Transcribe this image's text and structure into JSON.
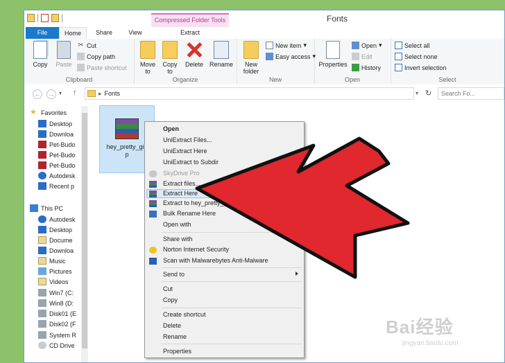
{
  "window": {
    "title": "Fonts",
    "context_tool": "Compressed Folder Tools"
  },
  "tabs": {
    "file": "File",
    "home": "Home",
    "share": "Share",
    "view": "View",
    "extract": "Extract"
  },
  "ribbon": {
    "clipboard": {
      "label": "Clipboard",
      "copy": "Copy",
      "paste": "Paste",
      "cut": "Cut",
      "copy_path": "Copy path",
      "paste_shortcut": "Paste shortcut"
    },
    "organize": {
      "label": "Organize",
      "move_to": "Move\nto",
      "copy_to": "Copy\nto",
      "delete": "Delete",
      "rename": "Rename"
    },
    "new": {
      "label": "New",
      "new_folder": "New\nfolder",
      "new_item": "New item",
      "easy_access": "Easy access"
    },
    "open": {
      "label": "Open",
      "properties": "Properties",
      "open": "Open",
      "edit": "Edit",
      "history": "History"
    },
    "select": {
      "label": "Select",
      "select_all": "Select all",
      "select_none": "Select none",
      "invert_selection": "Invert selection"
    }
  },
  "address": {
    "path": "Fonts",
    "search_placeholder": "Search Fo..."
  },
  "nav": {
    "favorites": "Favorites",
    "fav_items": [
      "Desktop",
      "Downloa",
      "Pet-Budo",
      "Pet-Budo",
      "Pet-Budo",
      "Autodesk",
      "Recent p"
    ],
    "this_pc": "This PC",
    "pc_items": [
      "Autodesk",
      "Desktop",
      "Docume",
      "Downloa",
      "Music",
      "Pictures",
      "Videos",
      "Win7 (C:",
      "Win8 (D:",
      "Disk01 (E",
      "Disk02 (F",
      "System R",
      "CD Drive"
    ]
  },
  "file": {
    "name_line1": "hey_pretty_girl",
    "name_line2": "p"
  },
  "context_menu": {
    "open": "Open",
    "uniextract_files": "UniExtract Files...",
    "uniextract_here": "UniExtract Here",
    "uniextract_subdir": "UniExtract to Subdir",
    "skydrive_pro": "SkyDrive Pro",
    "extract_files": "Extract files...",
    "extract_here": "Extract Here",
    "extract_to": "Extract to hey_pretty_girl\\",
    "bulk_rename": "Bulk Rename Here",
    "open_with": "Open with",
    "share_with": "Share with",
    "norton": "Norton Internet Security",
    "malwarebytes": "Scan with Malwarebytes Anti-Malware",
    "send_to": "Send to",
    "cut": "Cut",
    "copy": "Copy",
    "create_shortcut": "Create shortcut",
    "delete": "Delete",
    "rename": "Rename",
    "properties": "Properties"
  },
  "colors": {
    "arrow": "#e0282e",
    "accent": "#1979ca",
    "background": "#8dc16a"
  },
  "watermark": {
    "brand": "Bai经验",
    "url": "jingyan.baidu.com"
  }
}
